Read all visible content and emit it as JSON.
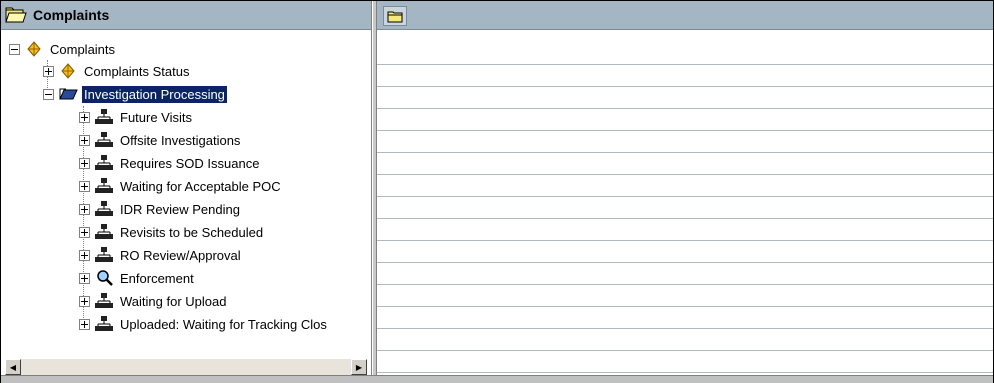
{
  "left_pane": {
    "title": "Complaints"
  },
  "tree": {
    "root": {
      "label": "Complaints",
      "icon": "cardinal-icon"
    },
    "level1": [
      {
        "label": "Complaints Status",
        "icon": "cardinal-icon",
        "expanded": false
      },
      {
        "label": "Investigation Processing",
        "icon": "blue-folder-icon",
        "expanded": true,
        "selected": true
      }
    ],
    "children": [
      {
        "label": "Future Visits",
        "icon": "org-chart-icon"
      },
      {
        "label": "Offsite Investigations",
        "icon": "org-chart-icon"
      },
      {
        "label": "Requires SOD Issuance",
        "icon": "org-chart-icon"
      },
      {
        "label": "Waiting for Acceptable POC",
        "icon": "org-chart-icon"
      },
      {
        "label": "IDR Review Pending",
        "icon": "org-chart-icon"
      },
      {
        "label": "Revisits to be Scheduled",
        "icon": "org-chart-icon"
      },
      {
        "label": "RO Review/Approval",
        "icon": "org-chart-icon"
      },
      {
        "label": "Enforcement",
        "icon": "magnifier-icon"
      },
      {
        "label": "Waiting for Upload",
        "icon": "org-chart-icon"
      },
      {
        "label": "Uploaded: Waiting for Tracking Clos",
        "icon": "org-chart-icon"
      }
    ]
  },
  "colors": {
    "header_bg": "#a4b5c4",
    "selection_bg": "#0a2466",
    "grid_line": "#b0b8c0"
  }
}
